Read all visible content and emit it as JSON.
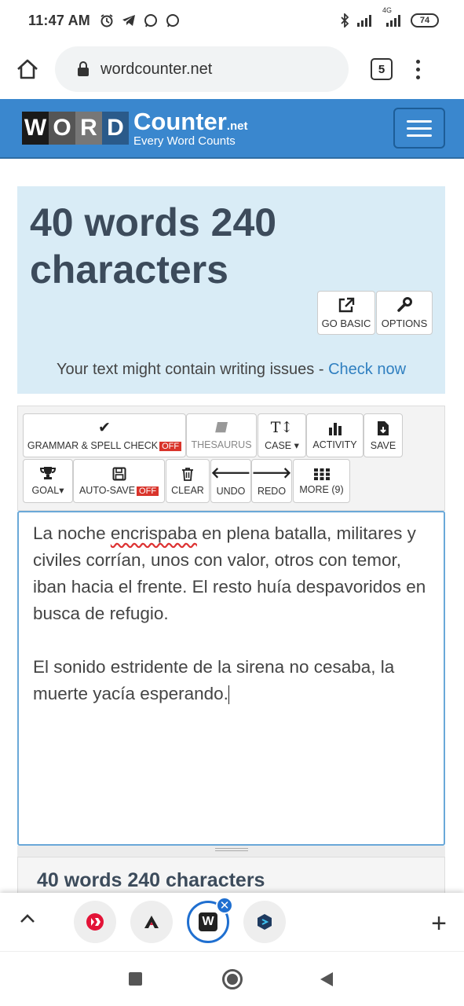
{
  "status_bar": {
    "time": "11:47 AM",
    "network": "4G",
    "battery": "74",
    "left_icons": [
      "alarm-icon",
      "telegram-icon",
      "whatsapp-icon",
      "whatsapp-icon"
    ],
    "right_icons": [
      "bluetooth-icon",
      "signal-icon",
      "signal-icon"
    ]
  },
  "browser": {
    "url": "wordcounter.net",
    "tab_count": "5"
  },
  "site": {
    "logo_letters": [
      "W",
      "O",
      "R",
      "D"
    ],
    "logo_name": "Counter",
    "logo_tld": ".net",
    "logo_tagline": "Every Word Counts"
  },
  "counter": {
    "headline": "40 words 240 characters",
    "go_basic": "GO BASIC",
    "options": "OPTIONS",
    "issues_text": "Your text might contain writing issues - ",
    "issues_link": "Check now"
  },
  "toolbar": {
    "grammar": "GRAMMAR & SPELL CHECK",
    "grammar_state": "OFF",
    "thesaurus": "THESAURUS",
    "case": "CASE",
    "activity": "ACTIVITY",
    "save": "SAVE",
    "goal": "GOAL",
    "autosave": "AUTO-SAVE",
    "autosave_state": "OFF",
    "clear": "CLEAR",
    "undo": "UNDO",
    "redo": "REDO",
    "more": "MORE (9)"
  },
  "editor": {
    "p1_before": "La noche ",
    "p1_misspelled": "encrispaba",
    "p1_after": " en plena batalla, militares y civiles corrían, unos con valor, otros con temor, iban hacia el frente. El resto huía despavoridos en busca de refugio.",
    "p2": "El sonido estridente de la sirena no cesaba, la muerte yacía esperando."
  },
  "bottom_count": "40 words 240 characters",
  "tab_strip": {
    "tabs": [
      "hive-icon",
      "ecency-icon",
      "wordcounter-icon",
      "peakd-icon"
    ],
    "active_label": "W"
  },
  "colors": {
    "header_blue": "#3a87ce",
    "panel_blue": "#d9ecf6",
    "link_blue": "#2f7fc0",
    "off_red": "#d9342b"
  }
}
